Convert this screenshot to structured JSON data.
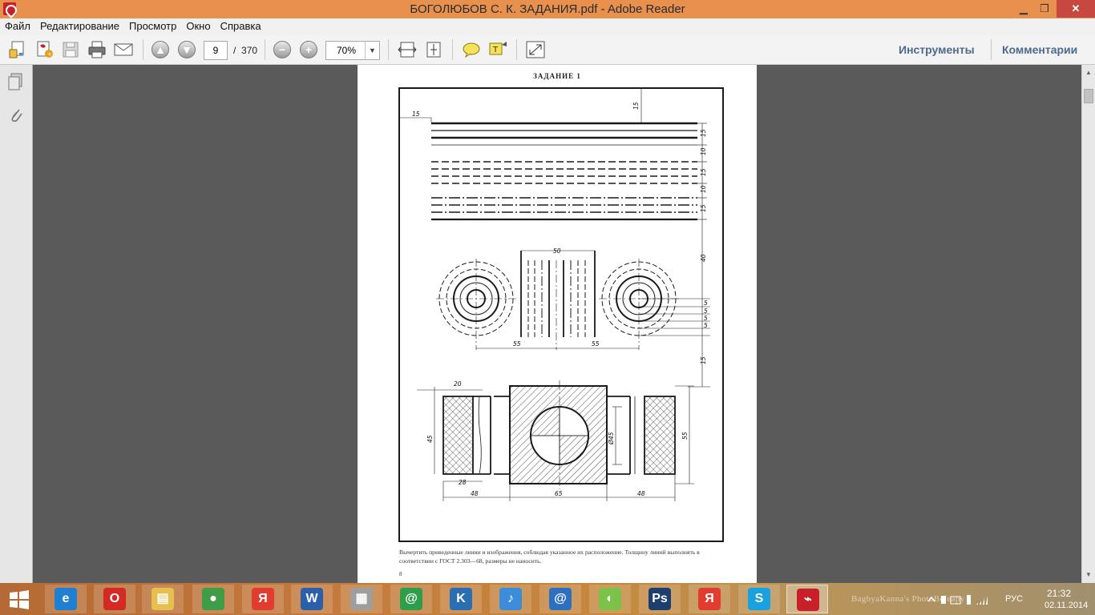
{
  "window": {
    "title": "БОГОЛЮБОВ С. К. ЗАДАНИЯ.pdf - Adobe Reader",
    "min_glyph": "▁",
    "max_glyph": "❐",
    "close_glyph": "✕"
  },
  "menu": {
    "items": [
      "Файл",
      "Редактирование",
      "Просмотр",
      "Окно",
      "Справка"
    ]
  },
  "toolbar": {
    "page_current": "9",
    "page_separator": "/",
    "page_total": "370",
    "zoom": "70%",
    "zoom_dropdown_glyph": "▼",
    "prev_glyph": "▲",
    "next_glyph": "▼",
    "zoom_out_glyph": "−",
    "zoom_in_glyph": "+",
    "tools_label": "Инструменты",
    "comments_label": "Комментарии"
  },
  "document": {
    "heading": "ЗАДАНИЕ 1",
    "caption": "Вычертить приведенные линии и изображения, соблюдая указанное их расположение. Толщину линий выполнять в соответствии с ГОСТ 2.303—68, размеры не наносить.",
    "page_number": "8",
    "dims": {
      "d15_top": "15",
      "d15_left": "15",
      "d15_a": "15",
      "d10_a": "10",
      "d15_b": "15",
      "d10_b": "10",
      "d15_c": "15",
      "d40": "40",
      "d50": "50",
      "d55_l": "55",
      "d55_r": "55",
      "d5_1": "5",
      "d5_2": "5",
      "d5_3": "5",
      "d5_4": "5",
      "d15_mid": "15",
      "d20": "20",
      "d45": "45",
      "d28": "28",
      "d48_l": "48",
      "d65": "65",
      "d48_r": "48",
      "d_dia45": "Ø45",
      "d55_h": "55"
    }
  },
  "scrollbar": {
    "up_glyph": "▲",
    "down_glyph": "▼"
  },
  "taskbar": {
    "watermark": "BagbyaKanna's PhotoBefeapy",
    "language": "РУС",
    "time": "21:32",
    "date": "02.11.2014",
    "apps": [
      {
        "name": "internet-explorer",
        "glyph": "e",
        "color": "#1f7fd0"
      },
      {
        "name": "opera",
        "glyph": "O",
        "color": "#d52a24"
      },
      {
        "name": "file-explorer",
        "glyph": "▤",
        "color": "#e7bf4e"
      },
      {
        "name": "chrome",
        "glyph": "●",
        "color": "#3f9c47"
      },
      {
        "name": "yandex-browser",
        "glyph": "Я",
        "color": "#e23b2f"
      },
      {
        "name": "word",
        "glyph": "W",
        "color": "#2b5fa8"
      },
      {
        "name": "archiver",
        "glyph": "▦",
        "color": "#9e9e9e"
      },
      {
        "name": "mail-agent",
        "glyph": "@",
        "color": "#2e9e4a"
      },
      {
        "name": "k-app",
        "glyph": "K",
        "color": "#2a6fb3"
      },
      {
        "name": "sound-app",
        "glyph": "♪",
        "color": "#3b8cd9"
      },
      {
        "name": "mail-ru",
        "glyph": "@",
        "color": "#2d6fc0"
      },
      {
        "name": "ball-app",
        "glyph": "◐",
        "color": "#7cc24a"
      },
      {
        "name": "photoshop",
        "glyph": "Ps",
        "color": "#1d3f6e"
      },
      {
        "name": "yandex",
        "glyph": "Я",
        "color": "#e23b2f"
      },
      {
        "name": "skype",
        "glyph": "S",
        "color": "#1aa1e0"
      },
      {
        "name": "adobe-reader",
        "glyph": "⌁",
        "color": "#c8202a"
      }
    ]
  }
}
